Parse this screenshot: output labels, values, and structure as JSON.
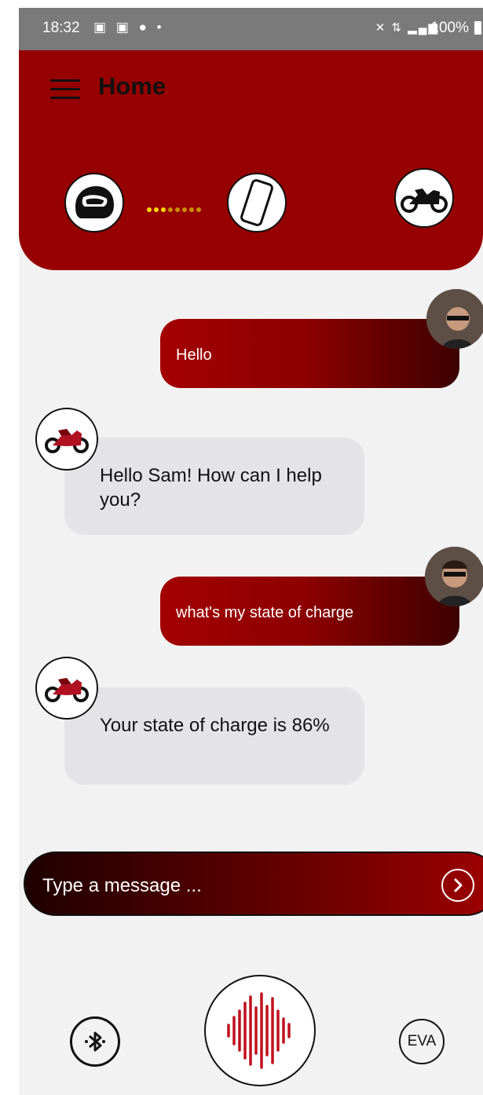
{
  "status_bar": {
    "time": "18:32",
    "left_icons": [
      "screenshot-icon",
      "screenshot-icon",
      "facebook-icon",
      "dot-icon"
    ],
    "right_icons": [
      "mute-icon",
      "4g-icon",
      "signal-icon"
    ],
    "battery": "100%"
  },
  "header": {
    "title": "Home",
    "menu_icon": "menu-icon",
    "connection_icons": [
      "helmet-icon",
      "phone-icon",
      "motorcycle-icon"
    ],
    "progress_dot_colors": [
      "#ffd700",
      "#ffd700",
      "#ffd700",
      "#c89000",
      "#c89000",
      "#c89000",
      "#c89000",
      "#c89000"
    ]
  },
  "chat": {
    "messages": [
      {
        "sender": "user",
        "text": "Hello"
      },
      {
        "sender": "bot",
        "text": "Hello Sam! How can I help you?"
      },
      {
        "sender": "user",
        "text": "what's my state of charge"
      },
      {
        "sender": "bot",
        "text": "Your state of charge is 86%"
      }
    ]
  },
  "input": {
    "placeholder": "Type a message ...",
    "send_icon": "chevron-right-icon"
  },
  "bottom_bar": {
    "bluetooth_icon": "bluetooth-icon",
    "voice_icon": "voice-wave-icon",
    "eva_label": "EVA"
  },
  "colors": {
    "header": "#960000",
    "background": "#f2f2f2",
    "bubble_in": "#e4e4e7",
    "accent": "#a30000"
  }
}
